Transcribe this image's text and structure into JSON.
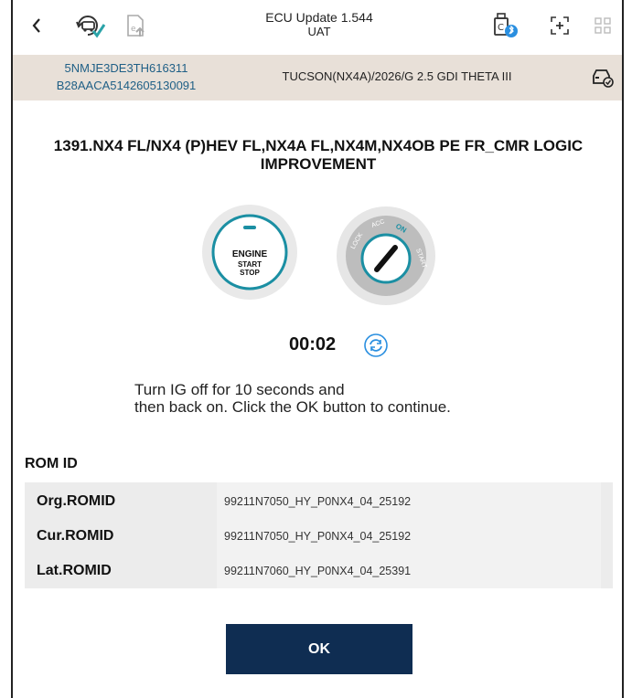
{
  "colors": {
    "accent": "#1b8fa3",
    "ok_button": "#0f2d52",
    "vehicle_bar": "#e8e0d8",
    "vin_text": "#1f5f86"
  },
  "header": {
    "title": "ECU Update 1.544",
    "subtitle": "UAT",
    "icons": [
      "back-icon",
      "car-update-icon",
      "document-upload-icon",
      "bluetooth-vci-icon",
      "screenshot-icon",
      "grid-menu-icon"
    ]
  },
  "vehicle": {
    "vin": "5NMJE3DE3TH616311",
    "id": "B28AACA5142605130091",
    "model": "TUCSON(NX4A)/2026/G 2.5 GDI THETA III",
    "icon": "vehicle-check-icon"
  },
  "main": {
    "heading": "1391.NX4 FL/NX4 (P)HEV FL,NX4A FL,NX4M,NX4OB PE FR_CMR LOGIC IMPROVEMENT",
    "engine_button": {
      "line1": "ENGINE",
      "line2": "START",
      "line3": "STOP"
    },
    "ignition": {
      "lock": "LOCK",
      "acc": "ACC",
      "on": "ON",
      "start": "START"
    },
    "timer": "00:02",
    "instruction_line1": "Turn IG off for 10 seconds and",
    "instruction_line2": "then back on. Click the OK button to continue."
  },
  "rom": {
    "title": "ROM ID",
    "rows": [
      {
        "label": "Org.ROMID",
        "value": "99211N7050_HY_P0NX4_04_25192"
      },
      {
        "label": "Cur.ROMID",
        "value": "99211N7050_HY_P0NX4_04_25192"
      },
      {
        "label": "Lat.ROMID",
        "value": "99211N7060_HY_P0NX4_04_25391"
      }
    ]
  },
  "actions": {
    "ok_label": "OK"
  }
}
